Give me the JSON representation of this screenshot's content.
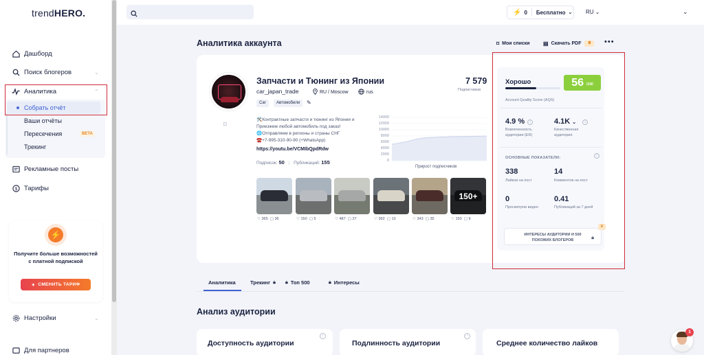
{
  "app": {
    "logo_light": "trend",
    "logo_bold": "HERO."
  },
  "sidebar": {
    "items": [
      {
        "label": "Дашборд"
      },
      {
        "label": "Поиск блогеров"
      },
      {
        "label": "Аналитика"
      },
      {
        "label": "Рекламные посты"
      },
      {
        "label": "Тарифы"
      },
      {
        "label": "Настройки"
      },
      {
        "label": "Для партнеров"
      }
    ],
    "sub_items": [
      {
        "label": "Собрать отчёт"
      },
      {
        "label": "Ваши отчёты"
      },
      {
        "label": "Пересечения"
      },
      {
        "label": "Трекинг"
      }
    ],
    "beta": "BETA",
    "promo": {
      "text": "Получите больше возможностей с платной подпиской",
      "button": "СМЕНИТЬ ТАРИФ"
    }
  },
  "topbar": {
    "search_placeholder": "",
    "credits": "0",
    "plan": "Бесплатно",
    "lang": "RU"
  },
  "main": {
    "title": "Аналитика аккаунта",
    "my_lists": "Мои списки",
    "download_pdf": "Скачать PDF",
    "account": {
      "name": "Запчасти и Тюнинг из Японии",
      "username": "car_japan_trade",
      "location": "RU / Moscow",
      "language": "rus",
      "tags": [
        "Car",
        "Автомобили"
      ],
      "followers": "7 579",
      "followers_label": "Подписчиков",
      "bio_lines": [
        "🛠️Контрактные запчасти и тюнинг из Японии и",
        "Приезжем любой автомобиль под заказ!",
        "🌐Отправляем в регионы и страны СНГ",
        "☎️+7-995-310-90-90 (+WhatsApp)"
      ],
      "bio_link": "https://youtu.be/VCMIbQpdRdw",
      "following_label": "Подписок:",
      "following": "50",
      "posts_label": "Публикаций:",
      "posts": "155",
      "avatar_text": "CAR JAPAN TRADE"
    },
    "growth_chart": {
      "caption": "Прирост подписчиков",
      "y_ticks": [
        "14000",
        "12000",
        "10000",
        "8000",
        "6000",
        "4000",
        "2000",
        "0"
      ]
    },
    "chart_data": {
      "type": "area",
      "title": "Прирост подписчиков",
      "y_ticks": [
        14000,
        12000,
        10000,
        8000,
        6000,
        4000,
        2000,
        0
      ],
      "ylim": [
        0,
        14000
      ],
      "grid": true
    },
    "posts_thumbs": [
      {
        "likes": "365",
        "comments": "36"
      },
      {
        "likes": "150",
        "comments": "5"
      },
      {
        "likes": "487",
        "comments": "27"
      },
      {
        "likes": "392",
        "comments": "13"
      },
      {
        "likes": "343",
        "comments": "35"
      },
      {
        "likes": "150",
        "comments": "9",
        "overlay": "150+"
      }
    ],
    "quality": {
      "label": "Хорошо",
      "score": "56",
      "score_suffix": "/100",
      "score_fraction": 0.56,
      "aqs_label": "Account Quality Score (AQS)",
      "engagement": "4.9 %",
      "engagement_label": "Вовлеченность аудитории (ER)",
      "quality_audience": "4.1K",
      "quality_audience_label": "Качественная аудитория",
      "main_head": "ОСНОВНЫЕ ПОКАЗАТЕЛИ:",
      "likes": "338",
      "likes_label": "Лайков на пост",
      "comments": "14",
      "comments_label": "Комментов на пост",
      "video_views": "0",
      "video_views_label": "Просмотров видео",
      "posts_week": "0.41",
      "posts_week_label": "Публикаций за 7 дней",
      "button": "ИНТЕРЕСЫ АУДИТОРИИ И 500 ПОХОЖИХ БЛОГЕРОВ"
    },
    "tabs": [
      {
        "label": "Аналитика"
      },
      {
        "label": "Трекинг"
      },
      {
        "label": "Топ 500"
      },
      {
        "label": "Интересы"
      }
    ],
    "section_title": "Анализ аудитории",
    "bottom_cards": [
      {
        "title": "Доступность аудитории"
      },
      {
        "title": "Подлинность аудитории"
      },
      {
        "title": "Среднее количество лайков"
      }
    ]
  },
  "chat": {
    "badge": "1"
  }
}
